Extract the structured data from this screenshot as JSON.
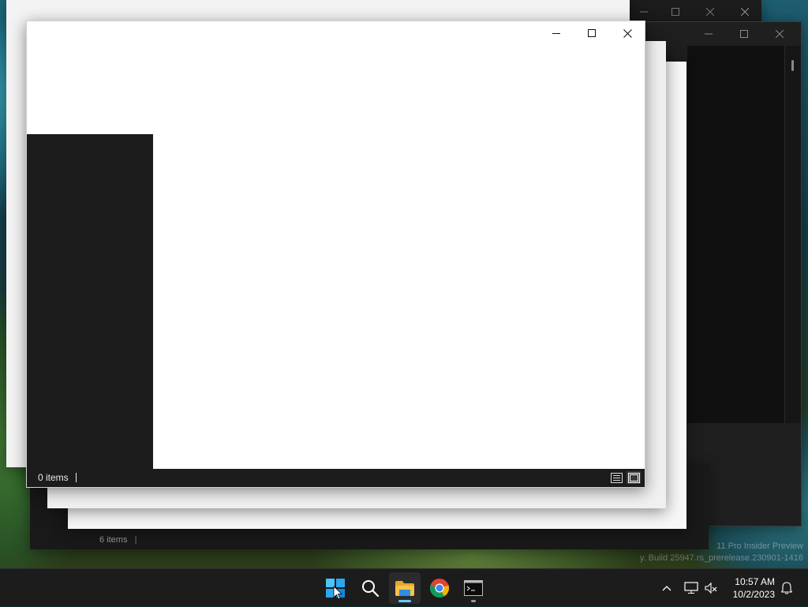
{
  "desktop": {
    "watermark_line1": "11 Pro Insider Preview",
    "watermark_line2": "y. Build 25947.rs_prerelease.230901-1416"
  },
  "front_window": {
    "status_count": "0 items",
    "controls": {
      "minimize": "minimize-icon",
      "maximize": "maximize-icon",
      "close": "close-icon"
    },
    "view_buttons": [
      "details-view-icon",
      "large-icons-view-icon"
    ]
  },
  "back_window": {
    "status_count": "6 items"
  },
  "taskbar": {
    "apps": [
      {
        "name": "start-icon",
        "color": "#4cc2ff"
      },
      {
        "name": "search-icon",
        "color": "#ffffff"
      },
      {
        "name": "file-explorer-icon",
        "color": "#f6c445",
        "active": true
      },
      {
        "name": "chrome-icon",
        "color": "#db4437"
      },
      {
        "name": "terminal-icon",
        "color": "#cccccc"
      }
    ],
    "tray_icons": [
      "chevron-up-icon",
      "network-icon",
      "volume-muted-icon"
    ],
    "clock": {
      "time": "10:57 AM",
      "date": "10/2/2023"
    },
    "notification_icon": "bell-icon",
    "accent": "#60cdff"
  }
}
